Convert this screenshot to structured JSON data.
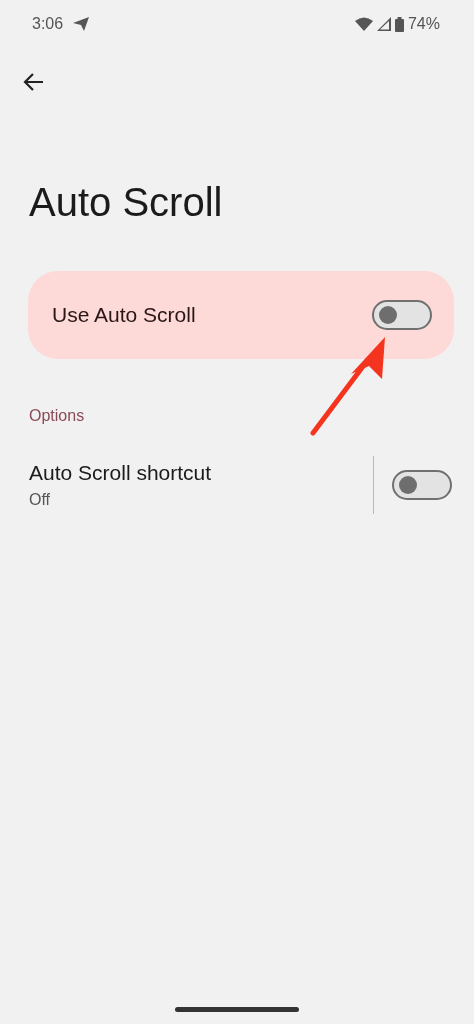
{
  "status_bar": {
    "time": "3:06",
    "battery": "74%"
  },
  "title": "Auto Scroll",
  "main_switch": {
    "label": "Use Auto Scroll",
    "on": false
  },
  "section_header": "Options",
  "settings": [
    {
      "title": "Auto Scroll shortcut",
      "summary": "Off",
      "on": false
    }
  ]
}
